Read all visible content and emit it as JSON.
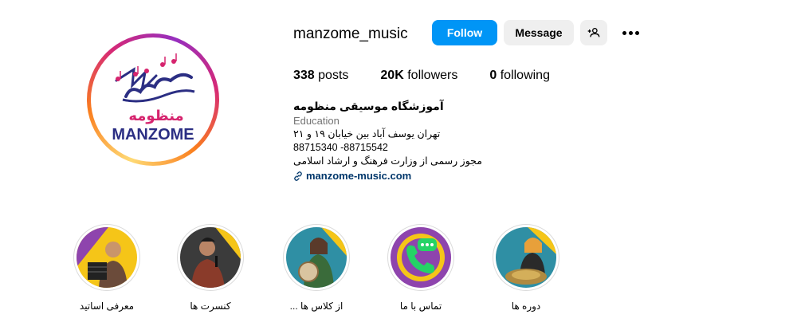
{
  "profile": {
    "username": "manzome_music",
    "logo_text": "MANZOME",
    "logo_script": "منظومه",
    "follow_label": "Follow",
    "message_label": "Message",
    "suggest_icon": "person-add-icon",
    "more_icon": "more-horizontal-icon"
  },
  "stats": [
    {
      "value": "338",
      "label": "posts"
    },
    {
      "value": "20K",
      "label": "followers"
    },
    {
      "value": "0",
      "label": "following"
    }
  ],
  "bio": {
    "name": "آموزشگاه موسیقی منظومه",
    "category": "Education",
    "lines": [
      "تهران یوسف آباد بین خیابان ۱۹ و ۲۱",
      "88715340 -88715542",
      "مجوز رسمی از وزارت فرهنگ و ارشاد اسلامی"
    ],
    "link": "manzome-music.com",
    "link_icon": "link-icon"
  },
  "highlights": [
    {
      "label": "معرفی اساتید"
    },
    {
      "label": "کنسرت ها"
    },
    {
      "label": "از کلاس ها ..."
    },
    {
      "label": "تماس با ما"
    },
    {
      "label": "دوره ها"
    }
  ],
  "colors": {
    "follow_bg": "#0095f6",
    "secondary_bg": "#efefef",
    "link": "#00376b",
    "muted": "#737373",
    "logo_navy": "#2b2e83",
    "logo_magenta": "#d6246e",
    "highlight_yellow": "#f5c518",
    "highlight_purple": "#8e44ad",
    "whatsapp_green": "#25d366"
  }
}
